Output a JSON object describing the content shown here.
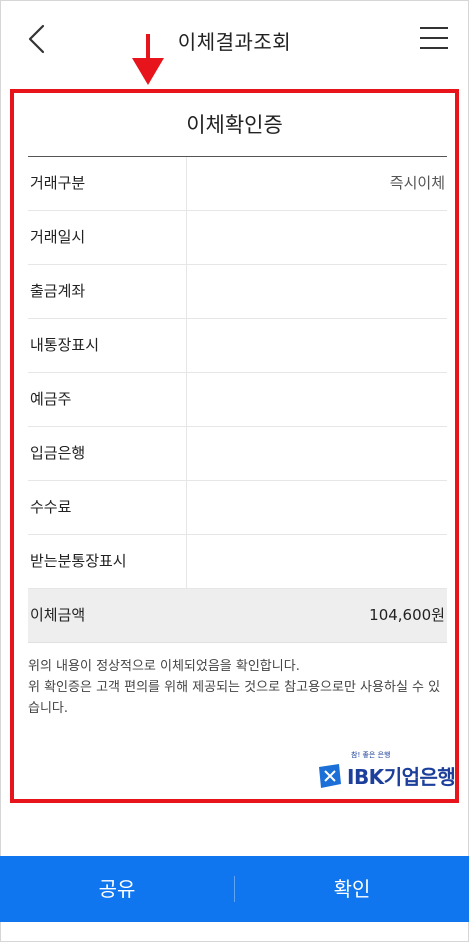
{
  "header": {
    "title": "이체결과조회",
    "back_icon": "chevron-left-icon",
    "menu_icon": "hamburger-menu-icon"
  },
  "annotation": {
    "arrow_color": "#e8141c",
    "frame_color": "#e8141c"
  },
  "receipt": {
    "title": "이체확인증",
    "rows": [
      {
        "label": "거래구분",
        "value": "즉시이체"
      },
      {
        "label": "거래일시",
        "value": ""
      },
      {
        "label": "출금계좌",
        "value": ""
      },
      {
        "label": "내통장표시",
        "value": ""
      },
      {
        "label": "예금주",
        "value": ""
      },
      {
        "label": "입금은행",
        "value": ""
      },
      {
        "label": "수수료",
        "value": ""
      },
      {
        "label": "받는분통장표시",
        "value": ""
      }
    ],
    "total": {
      "label": "이체금액",
      "value": "104,600원"
    },
    "notice_lines": [
      "위의 내용이 정상적으로 이체되었음을 확인합니다.",
      "위 확인증은 고객 편의를 위해 제공되는 것으로 참고용으로만 사용하실 수 있습니다."
    ],
    "logo": {
      "slogan": "참! 좋은 은행",
      "brand": "IBK",
      "name": "기업은행",
      "color": "#1b3f9a"
    }
  },
  "bottom_bar": {
    "share_label": "공유",
    "confirm_label": "확인",
    "color": "#1076f0"
  }
}
